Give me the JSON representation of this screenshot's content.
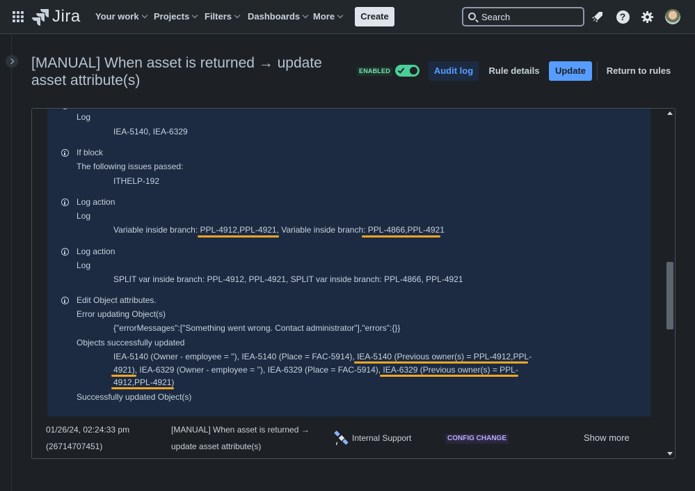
{
  "nav": {
    "logo_text": "Jira",
    "items": [
      "Your work",
      "Projects",
      "Filters",
      "Dashboards",
      "More"
    ],
    "create_label": "Create",
    "search_placeholder": "Search"
  },
  "header": {
    "title": "[MANUAL] When asset is returned → update asset attribute(s)",
    "status_badge": "ENABLED",
    "toggle_on": true,
    "audit_log_label": "Audit log",
    "rule_details_label": "Rule details",
    "update_label": "Update",
    "return_label": "Return to rules"
  },
  "log": {
    "entries": [
      {
        "lines": [
          "Log",
          "IEA-5140, IEA-6329"
        ]
      },
      {
        "title": "If block",
        "lines": [
          "The following issues passed:",
          "ITHELP-192"
        ]
      },
      {
        "title": "Log action",
        "lines": [
          "Log",
          "Variable inside branch: PPL-4912,PPL-4921, Variable inside branch: PPL-4866,PPL-4921"
        ]
      },
      {
        "title": "Log action",
        "lines": [
          "Log",
          "SPLIT var inside branch: PPL-4912, PPL-4921, SPLIT var inside branch: PPL-4866, PPL-4921"
        ]
      },
      {
        "title": "Edit Object attributes.",
        "lines": [
          "Error updating Object(s)",
          "{\"errorMessages\":[\"Something went wrong. Contact administrator\"],\"errors\":{}}",
          "Objects successfully updated",
          "IEA-5140 (Owner - employee = ''), IEA-5140 (Place = FAC-5914), IEA-5140 (Previous owner(s) = PPL-4912,PPL-",
          "4921), IEA-6329 (Owner - employee = ''), IEA-6329 (Place = FAC-5914), IEA-6329 (Previous owner(s) = PPL-",
          "4912,PPL-4921)",
          "Successfully updated Object(s)"
        ]
      }
    ]
  },
  "audit_row": {
    "date": "01/26/24, 02:24:33 pm",
    "id": "(26714707451)",
    "rule_line1": "[MANUAL] When asset is returned →",
    "rule_line2": "update asset attribute(s)",
    "actor": "Internal Support",
    "category": "CONFIG CHANGE",
    "show_more": "Show more"
  },
  "colors": {
    "background": "#1d2125",
    "log_background": "#1c2b42",
    "highlight_underline": "#f5a623",
    "primary": "#579dff",
    "success": "#4bce97"
  }
}
